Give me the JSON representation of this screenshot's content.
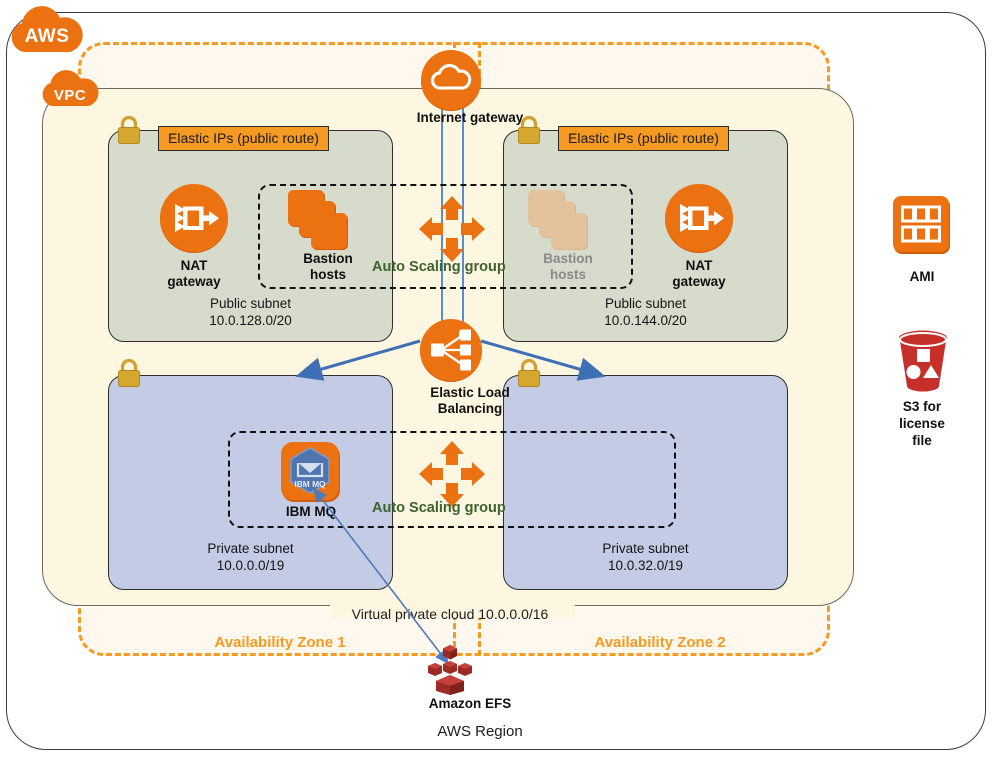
{
  "diagram": {
    "title": "AWS Region",
    "region_label": "AWS Region",
    "vpc_label": "Virtual private cloud 10.0.0.0/16",
    "cloud_tags": {
      "aws": "AWS",
      "vpc": "VPC"
    },
    "availability_zones": [
      {
        "label": "Availability  Zone 1"
      },
      {
        "label": "Availability  Zone 2"
      }
    ],
    "internet_gateway": {
      "label": "Internet gateway",
      "icon": "cloud-icon"
    },
    "elastic_load_balancing": {
      "label": "Elastic Load\nBalancing",
      "line1": "Elastic Load",
      "line2": "Balancing",
      "icon": "load-balancer-icon"
    },
    "auto_scaling_groups": [
      {
        "label": "Auto Scaling group",
        "icon": "auto-scaling-arrows-icon"
      },
      {
        "label": "Auto Scaling group",
        "icon": "auto-scaling-arrows-icon"
      }
    ],
    "public_subnets": [
      {
        "eip_tag": "Elastic IPs (public route)",
        "caption_line1": "Public subnet",
        "caption_line2": "10.0.128.0/20",
        "nat_gateway_label": "NAT\ngateway",
        "nat_line1": "NAT",
        "nat_line2": "gateway",
        "bastion_label": "Bastion\nhosts",
        "bastion_line1": "Bastion",
        "bastion_line2": "hosts",
        "bastion_active": true
      },
      {
        "eip_tag": "Elastic IPs (public route)",
        "caption_line1": "Public subnet",
        "caption_line2": "10.0.144.0/20",
        "nat_gateway_label": "NAT\ngateway",
        "nat_line1": "NAT",
        "nat_line2": "gateway",
        "bastion_label": "Bastion\nhosts",
        "bastion_line1": "Bastion",
        "bastion_line2": "hosts",
        "bastion_active": false
      }
    ],
    "private_subnets": [
      {
        "caption_line1": "Private subnet",
        "caption_line2": "10.0.0.0/19",
        "node_label": "IBM  MQ",
        "node_icon": "ibm-mq-icon"
      },
      {
        "caption_line1": "Private subnet",
        "caption_line2": "10.0.32.0/19",
        "node_label": "",
        "node_icon": ""
      }
    ],
    "external_services": [
      {
        "label": "AMI",
        "icon": "ami-icon"
      },
      {
        "label": "S3 for\nlicense\nfile",
        "line1": "S3 for",
        "line2": "license",
        "line3": "file",
        "icon": "s3-bucket-icon"
      }
    ],
    "efs": {
      "label": "Amazon EFS",
      "icon": "efs-icon"
    },
    "ibm_mq_badge_text": "IBM MQ",
    "colors": {
      "aws_orange": "#EC7211",
      "tag_orange": "#F59A23",
      "public_subnet_fill": "#D6DBCB",
      "private_subnet_fill": "#C3CCE4",
      "vpc_fill": "#FDF6E1",
      "asg_green": "#3C6330",
      "arrow_blue": "#3F6FB5",
      "pipe_blue": "#5B8CCB",
      "lock_gold": "#D3A02E",
      "s3_red": "#C5302B",
      "efs_red": "#B5342C",
      "mq_blue": "#5A7FB5"
    }
  }
}
